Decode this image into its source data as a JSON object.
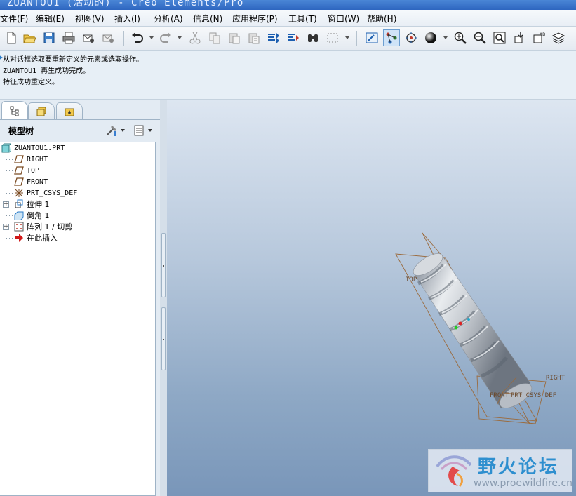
{
  "window": {
    "title": "ZUANTOU1 (活动的) - Creo Elements/Pro"
  },
  "menubar": {
    "items": [
      {
        "label": "文件(F)"
      },
      {
        "label": "编辑(E)"
      },
      {
        "label": "视图(V)"
      },
      {
        "label": "插入(I)"
      },
      {
        "label": "分析(A)"
      },
      {
        "label": "信息(N)"
      },
      {
        "label": "应用程序(P)"
      },
      {
        "label": "工具(T)"
      },
      {
        "label": "窗口(W)"
      },
      {
        "label": "帮助(H)"
      }
    ]
  },
  "toolbar": {
    "icons": [
      "new-file-icon",
      "open-folder-icon",
      "save-icon",
      "print-icon",
      "email-icon",
      "email-link-icon",
      "undo-icon",
      "redo-icon",
      "cut-icon",
      "copy-icon",
      "paste-icon",
      "paste-special-icon",
      "regenerate-icon",
      "regenerate-manager-icon",
      "find-icon",
      "select-box-icon",
      "repaint-icon",
      "spin-center-icon",
      "orient-mode-icon",
      "shading-icon",
      "zoom-in-icon",
      "zoom-out-icon",
      "refit-icon",
      "reorient-icon",
      "saved-views-icon",
      "layers-icon"
    ]
  },
  "messages": [
    {
      "text": "从对话框选取要重新定义的元素或选取操作。",
      "has_arrow": true
    },
    {
      "text": "ZUANTOU1 再生成功完成。",
      "has_arrow": false
    },
    {
      "text": "特征成功重定义。",
      "has_arrow": false
    }
  ],
  "model_tree": {
    "title": "模型树",
    "items": [
      {
        "label": "ZUANTOU1.PRT",
        "icon": "part-icon",
        "expander": ""
      },
      {
        "label": "RIGHT",
        "icon": "datum-plane-icon",
        "expander": ""
      },
      {
        "label": "TOP",
        "icon": "datum-plane-icon",
        "expander": ""
      },
      {
        "label": "FRONT",
        "icon": "datum-plane-icon",
        "expander": ""
      },
      {
        "label": "PRT_CSYS_DEF",
        "icon": "coordinate-system-icon",
        "expander": ""
      },
      {
        "label": "拉伸 1",
        "icon": "extrude-icon",
        "expander": "+"
      },
      {
        "label": "倒角 1",
        "icon": "chamfer-icon",
        "expander": ""
      },
      {
        "label": "阵列 1 / 切剪",
        "icon": "pattern-icon",
        "expander": "+"
      },
      {
        "label": "在此插入",
        "icon": "insert-here-arrow-icon",
        "expander": ""
      }
    ]
  },
  "viewport": {
    "datum_labels": {
      "top": "TOP",
      "right": "RIGHT",
      "front": "FRONT",
      "csys": "PRT_CSYS_DEF"
    },
    "colors": {
      "datum": "#9b6a3c",
      "part": "#c8cdd3"
    }
  },
  "watermark": {
    "name": "野火论坛",
    "url": "www.proewildfire.cn"
  }
}
